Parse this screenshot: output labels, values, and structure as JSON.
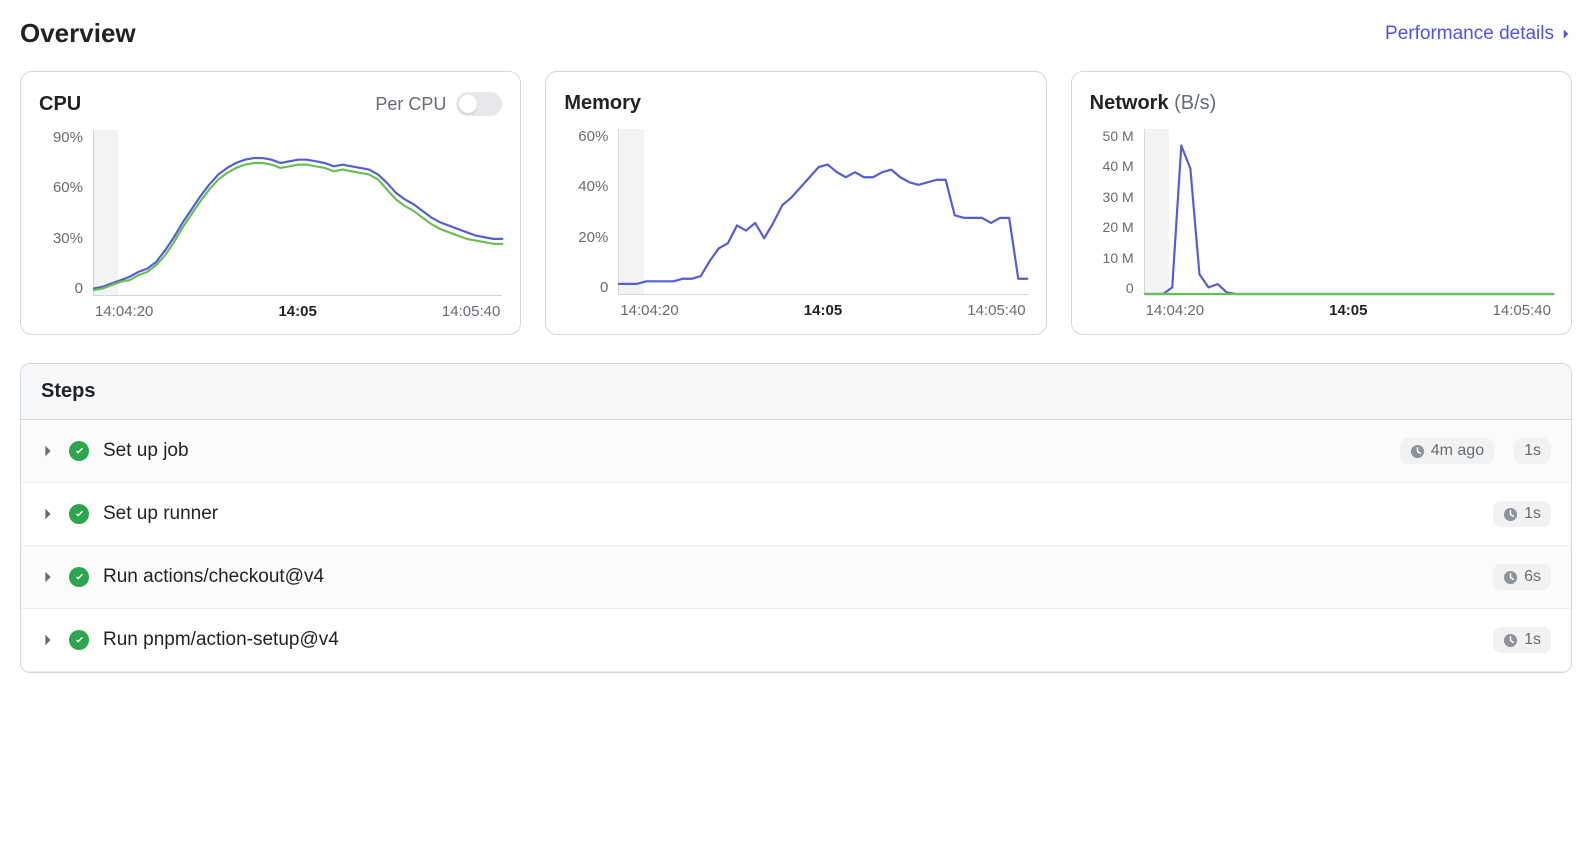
{
  "header": {
    "title": "Overview",
    "perf_link": "Performance details"
  },
  "cards": {
    "cpu": {
      "title": "CPU",
      "toggle_label": "Per CPU",
      "y_ticks": [
        "90%",
        "60%",
        "30%",
        "0"
      ],
      "x_ticks": [
        "14:04:20",
        "14:05",
        "14:05:40"
      ]
    },
    "memory": {
      "title": "Memory",
      "y_ticks": [
        "60%",
        "40%",
        "20%",
        "0"
      ],
      "x_ticks": [
        "14:04:20",
        "14:05",
        "14:05:40"
      ]
    },
    "network": {
      "title": "Network",
      "unit": "(B/s)",
      "y_ticks": [
        "50 M",
        "40 M",
        "30 M",
        "20 M",
        "10 M",
        "0"
      ],
      "x_ticks": [
        "14:04:20",
        "14:05",
        "14:05:40"
      ]
    }
  },
  "steps": {
    "header": "Steps",
    "rows": [
      {
        "name": "Set up job",
        "rel": "4m ago",
        "dur": "1s"
      },
      {
        "name": "Set up runner",
        "rel": "",
        "dur": "1s"
      },
      {
        "name": "Run actions/checkout@v4",
        "rel": "",
        "dur": "6s"
      },
      {
        "name": "Run pnpm/action-setup@v4",
        "rel": "",
        "dur": "1s"
      }
    ]
  },
  "colors": {
    "series_blue": "#5560d0",
    "series_green": "#6bbf59"
  },
  "chart_data": [
    {
      "type": "line",
      "title": "CPU",
      "ylabel": "",
      "ylim": [
        0,
        100
      ],
      "x_ticks": [
        "14:04:20",
        "14:05",
        "14:05:40"
      ],
      "series": [
        {
          "name": "cpu-blue",
          "color": "#5560d0",
          "values": [
            4,
            5,
            7,
            9,
            11,
            14,
            16,
            20,
            27,
            35,
            44,
            52,
            60,
            67,
            73,
            77,
            80,
            82,
            83,
            83,
            82,
            80,
            81,
            82,
            82,
            81,
            80,
            78,
            79,
            78,
            77,
            76,
            73,
            68,
            62,
            58,
            55,
            51,
            47,
            44,
            42,
            40,
            38,
            36,
            35,
            34,
            34
          ]
        },
        {
          "name": "cpu-green",
          "color": "#6bbf59",
          "values": [
            3,
            4,
            6,
            8,
            9,
            12,
            14,
            18,
            24,
            32,
            41,
            49,
            57,
            64,
            70,
            74,
            77,
            79,
            80,
            80,
            79,
            77,
            78,
            79,
            79,
            78,
            77,
            75,
            76,
            75,
            74,
            73,
            70,
            64,
            58,
            54,
            51,
            47,
            43,
            40,
            38,
            36,
            34,
            33,
            32,
            31,
            31
          ]
        }
      ]
    },
    {
      "type": "line",
      "title": "Memory",
      "ylabel": "",
      "ylim": [
        0,
        65
      ],
      "x_ticks": [
        "14:04:20",
        "14:05",
        "14:05:40"
      ],
      "series": [
        {
          "name": "memory",
          "color": "#5560d0",
          "values": [
            4,
            4,
            4,
            5,
            5,
            5,
            5,
            6,
            6,
            7,
            13,
            18,
            20,
            27,
            25,
            28,
            22,
            28,
            35,
            38,
            42,
            46,
            50,
            51,
            48,
            46,
            48,
            46,
            46,
            48,
            49,
            46,
            44,
            43,
            44,
            45,
            45,
            31,
            30,
            30,
            30,
            28,
            30,
            30,
            6,
            6
          ]
        }
      ]
    },
    {
      "type": "line",
      "title": "Network (B/s)",
      "ylabel": "",
      "ylim": [
        0,
        50000000
      ],
      "x_ticks": [
        "14:04:20",
        "14:05",
        "14:05:40"
      ],
      "series": [
        {
          "name": "net-blue",
          "color": "#5560d0",
          "values": [
            0,
            0,
            0,
            2000000,
            45000000,
            38000000,
            6000000,
            2000000,
            3000000,
            500000,
            0,
            0,
            0,
            0,
            0,
            0,
            0,
            0,
            0,
            0,
            0,
            0,
            0,
            0,
            0,
            0,
            0,
            0,
            0,
            0,
            0,
            0,
            0,
            0,
            0,
            0,
            0,
            0,
            0,
            0,
            0,
            0,
            0,
            0,
            0,
            0
          ]
        },
        {
          "name": "net-green",
          "color": "#6bbf59",
          "values": [
            0,
            0,
            0,
            0,
            0,
            0,
            0,
            0,
            0,
            0,
            0,
            0,
            0,
            0,
            0,
            0,
            0,
            0,
            0,
            0,
            0,
            0,
            0,
            0,
            0,
            0,
            0,
            0,
            0,
            0,
            0,
            0,
            0,
            0,
            0,
            0,
            0,
            0,
            0,
            0,
            0,
            0,
            0,
            0,
            0,
            0
          ]
        }
      ]
    }
  ]
}
